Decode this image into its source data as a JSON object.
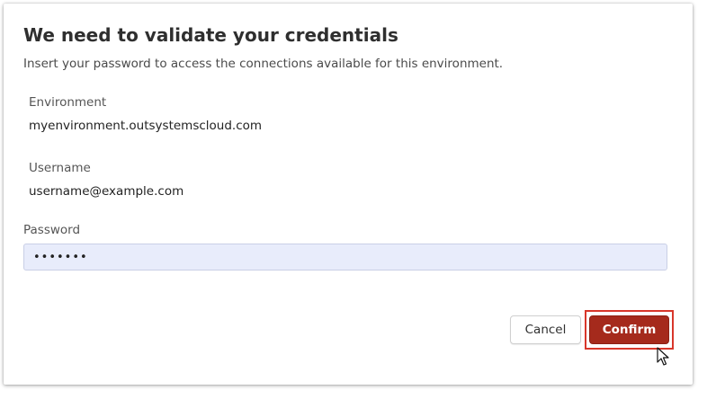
{
  "dialog": {
    "title": "We need to validate your credentials",
    "subtitle": "Insert your password to access the connections available for this environment."
  },
  "fields": {
    "environment": {
      "label": "Environment",
      "value": "myenvironment.outsystemscloud.com"
    },
    "username": {
      "label": "Username",
      "value": "username@example.com"
    },
    "password": {
      "label": "Password",
      "value": "•••••••"
    }
  },
  "actions": {
    "cancel_label": "Cancel",
    "confirm_label": "Confirm"
  },
  "colors": {
    "confirm_button": "#a52a1c",
    "highlight_border": "#d8372b",
    "password_field_bg": "#e8ecfb"
  },
  "icons": {
    "cursor": "mouse-pointer-icon"
  }
}
